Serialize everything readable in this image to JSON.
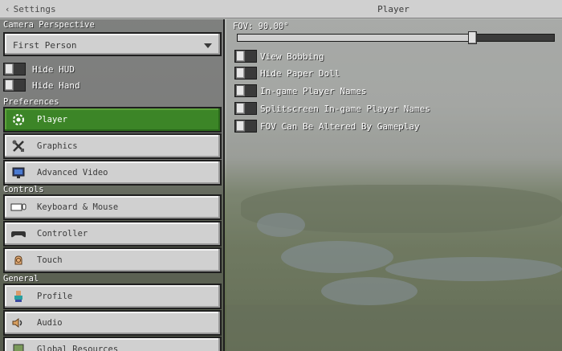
{
  "header": {
    "back_label": "Settings",
    "title": "Player"
  },
  "sidebar": {
    "camera_section": "Camera Perspective",
    "camera_value": "First Person",
    "hide_hud": "Hide HUD",
    "hide_hand": "Hide Hand",
    "preferences_section": "Preferences",
    "preferences": [
      {
        "label": "Player",
        "icon": "player-settings-icon",
        "selected": true
      },
      {
        "label": "Graphics",
        "icon": "tools-icon"
      },
      {
        "label": "Advanced Video",
        "icon": "monitor-icon"
      }
    ],
    "controls_section": "Controls",
    "controls": [
      {
        "label": "Keyboard & Mouse",
        "icon": "keyboard-mouse-icon"
      },
      {
        "label": "Controller",
        "icon": "controller-icon"
      },
      {
        "label": "Touch",
        "icon": "touch-hand-icon"
      }
    ],
    "general_section": "General",
    "general": [
      {
        "label": "Profile",
        "icon": "profile-icon"
      },
      {
        "label": "Audio",
        "icon": "speaker-icon"
      },
      {
        "label": "Global Resources",
        "icon": "resources-icon"
      }
    ]
  },
  "player": {
    "fov_label": "FOV: 90.00°",
    "fov_fraction": 0.75,
    "toggles": [
      {
        "label": "View Bobbing",
        "on": false
      },
      {
        "label": "Hide Paper Doll",
        "on": false
      },
      {
        "label": "In-game Player Names",
        "on": false
      },
      {
        "label": "Splitscreen In-game Player Names",
        "on": false
      },
      {
        "label": "FOV Can Be Altered By Gameplay",
        "on": false
      }
    ]
  },
  "colors": {
    "selected_green": "#3c8527",
    "button_gray": "#d0d0d0"
  }
}
